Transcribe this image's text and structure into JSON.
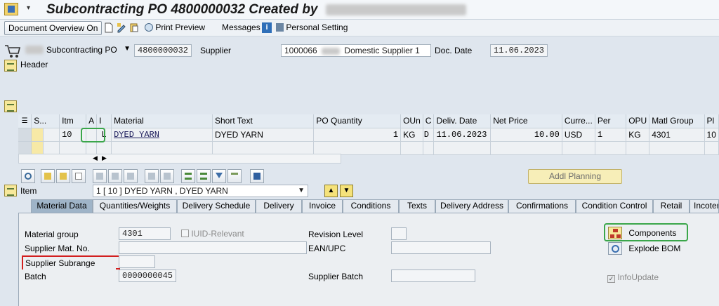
{
  "window": {
    "title": "Subcontracting PO 4800000032 Created by",
    "menu_arrow": "▾"
  },
  "toolbar": {
    "document_overview": "Document Overview On",
    "print_preview": "Print Preview",
    "messages": "Messages",
    "personal_setting": "Personal Setting"
  },
  "header": {
    "po_type": "Subcontracting PO",
    "po_number": "4800000032",
    "supplier_label": "Supplier",
    "supplier_id": "1000066",
    "supplier_name": "Domestic Supplier 1",
    "doc_date_label": "Doc. Date",
    "doc_date": "11.06.2023",
    "header_label": "Header"
  },
  "grid": {
    "columns": [
      "S...",
      "Itm",
      "A",
      "I",
      "Material",
      "Short Text",
      "PO Quantity",
      "OUn",
      "C",
      "Deliv. Date",
      "Net Price",
      "Curre...",
      "Per",
      "OPU",
      "Matl Group",
      "Pl"
    ],
    "row": {
      "itm": "10",
      "a": "",
      "i": "L",
      "material": "DYED YARN",
      "short_text": "DYED YARN",
      "po_quantity": "1",
      "oun": "KG",
      "c": "D",
      "deliv_date": "11.06.2023",
      "net_price": "10.00",
      "currency": "USD",
      "per": "1",
      "opu": "KG",
      "matl_group": "4301",
      "pl": "10"
    }
  },
  "item": {
    "label": "Item",
    "selected": "1 [ 10 ] DYED YARN , DYED YARN",
    "addl_planning": "Addl Planning"
  },
  "tabs": [
    "Material Data",
    "Quantities/Weights",
    "Delivery Schedule",
    "Delivery",
    "Invoice",
    "Conditions",
    "Texts",
    "Delivery Address",
    "Confirmations",
    "Condition Control",
    "Retail",
    "Incoter"
  ],
  "material_data": {
    "material_group_label": "Material group",
    "material_group": "4301",
    "iuid_label": "IUID-Relevant",
    "revision_level_label": "Revision Level",
    "supplier_mat_no_label": "Supplier Mat. No.",
    "ean_upc_label": "EAN/UPC",
    "supplier_subrange_label": "Supplier Subrange",
    "batch_label": "Batch",
    "batch": "0000000045",
    "supplier_batch_label": "Supplier Batch",
    "components_label": "Components",
    "explode_bom_label": "Explode BOM",
    "infoupdate_label": "InfoUpdate"
  }
}
